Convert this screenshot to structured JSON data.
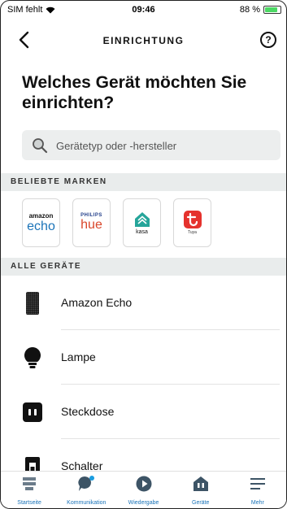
{
  "status": {
    "carrier": "SIM fehlt",
    "time": "09:46",
    "battery": "88 %",
    "battery_level": 0.88
  },
  "header": {
    "title": "EINRICHTUNG",
    "help_label": "?"
  },
  "heading": "Welches Gerät möchten Sie einrichten?",
  "search": {
    "placeholder": "Gerätetyp oder -hersteller"
  },
  "popular": {
    "label": "BELIEBTE MARKEN",
    "brands": [
      {
        "small": "amazon",
        "big": "echo"
      },
      {
        "small": "PHILIPS",
        "big": "hue"
      },
      {
        "text": "kasa"
      },
      {
        "text": "Tuya"
      }
    ]
  },
  "all_devices": {
    "label": "ALLE GERÄTE",
    "items": [
      "Amazon Echo",
      "Lampe",
      "Steckdose",
      "Schalter"
    ]
  },
  "tabs": [
    "Startseite",
    "Kommunikation",
    "Wiedergabe",
    "Geräte",
    "Mehr"
  ],
  "colors": {
    "accent": "#1a73b8",
    "tuya": "#e5322d",
    "kasa": "#25a59a"
  }
}
